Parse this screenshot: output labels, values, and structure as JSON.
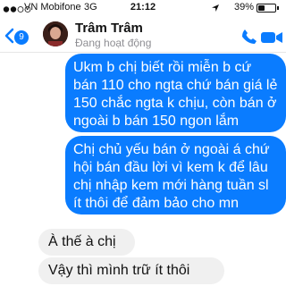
{
  "status_bar": {
    "carrier": "VN Mobifone",
    "network": "3G",
    "time": "21:12",
    "battery_percent_text": "39%",
    "battery_level": 0.39,
    "signal_bars": 2
  },
  "header": {
    "unread_count": "9",
    "contact_name": "Trâm Trâm",
    "presence": "Đang hoạt động",
    "accent_color": "#0a7cff",
    "icons": [
      "chevron-left-icon",
      "phone-icon",
      "video-camera-icon",
      "location-arrow-icon",
      "battery-icon"
    ]
  },
  "messages": [
    {
      "direction": "outgoing",
      "text": "Ukm b chị biết rồi miễn b cứ bán 110 cho ngta chứ bán giá lẻ 150 chắc ngta k chịu, còn bán ở ngoài b bán 150 ngon lắm"
    },
    {
      "direction": "outgoing",
      "text": "Chị chủ yếu bán ở ngoài á chứ hội bán đầu lời vì kem k để lâu chị nhập kem mới hàng tuần sl ít thôi  để đảm bảo cho mn"
    },
    {
      "direction": "incoming",
      "text": "À thế à chị"
    },
    {
      "direction": "incoming",
      "text": "Vậy thì mình trữ ít thôi"
    }
  ]
}
